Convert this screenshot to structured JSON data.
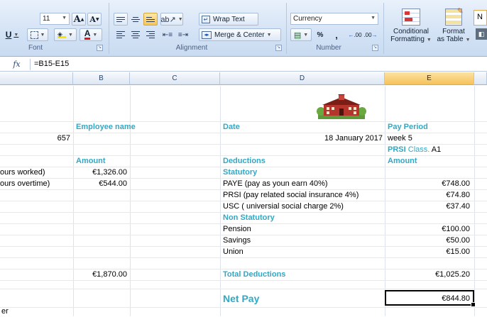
{
  "ribbon": {
    "font": {
      "size": "11",
      "grow_label": "A",
      "shrink_label": "A",
      "underline_label": "U",
      "font_color_label": "A",
      "group_label": "Font"
    },
    "alignment": {
      "wrap_text_label": "Wrap Text",
      "merge_center_label": "Merge & Center",
      "group_label": "Alignment"
    },
    "number": {
      "format_value": "Currency",
      "percent_label": "%",
      "comma_label": ",",
      "inc_decimal_label": ".00",
      "dec_decimal_label": ".00",
      "group_label": "Number"
    },
    "styles": {
      "conditional_line1": "Conditional",
      "conditional_line2": "Formatting",
      "format_table_line1": "Format",
      "format_table_line2": "as Table",
      "next_style": "N"
    }
  },
  "formula_bar": {
    "fx": "fx",
    "formula": "=B15-E15"
  },
  "columns": {
    "b": "B",
    "c": "C",
    "d": "D",
    "e": "E"
  },
  "sheet": {
    "employee_name_header": "Employee name",
    "date_header": "Date",
    "pay_period_header": "Pay Period",
    "employee_number": "657",
    "date_value": "18 January 2017",
    "pay_period_value": "week 5",
    "prsi_label": "PRSI",
    "class_label": "Class.",
    "class_value": "A1",
    "amount_header_left": "Amount",
    "deductions_header": "Deductions",
    "amount_header_right": "Amount",
    "hours_worked_label": "ours worked)",
    "hours_worked_amount": "€1,326.00",
    "statutory_label": "Statutory",
    "hours_overtime_label": "ours overtime)",
    "hours_overtime_amount": "€544.00",
    "paye_label": "PAYE (pay as youn earn 40%)",
    "paye_amount": "€748.00",
    "prsi_deduction_label": "PRSI (pay related social insurance 4%)",
    "prsi_amount": "€74.80",
    "usc_label": "USC ( universial social charge 2%)",
    "usc_amount": "€37.40",
    "non_statutory_label": "Non Statutory",
    "pension_label": "Pension",
    "pension_amount": "€100.00",
    "savings_label": "Savings",
    "savings_amount": "€50.00",
    "union_label": "Union",
    "union_amount": "€15.00",
    "gross_total": "€1,870.00",
    "total_deductions_label": "Total Deductions",
    "total_deductions_amount": "€1,025.20",
    "net_pay_label": "Net Pay",
    "net_pay_amount": "€844.80",
    "bottom_fragment": "er"
  }
}
